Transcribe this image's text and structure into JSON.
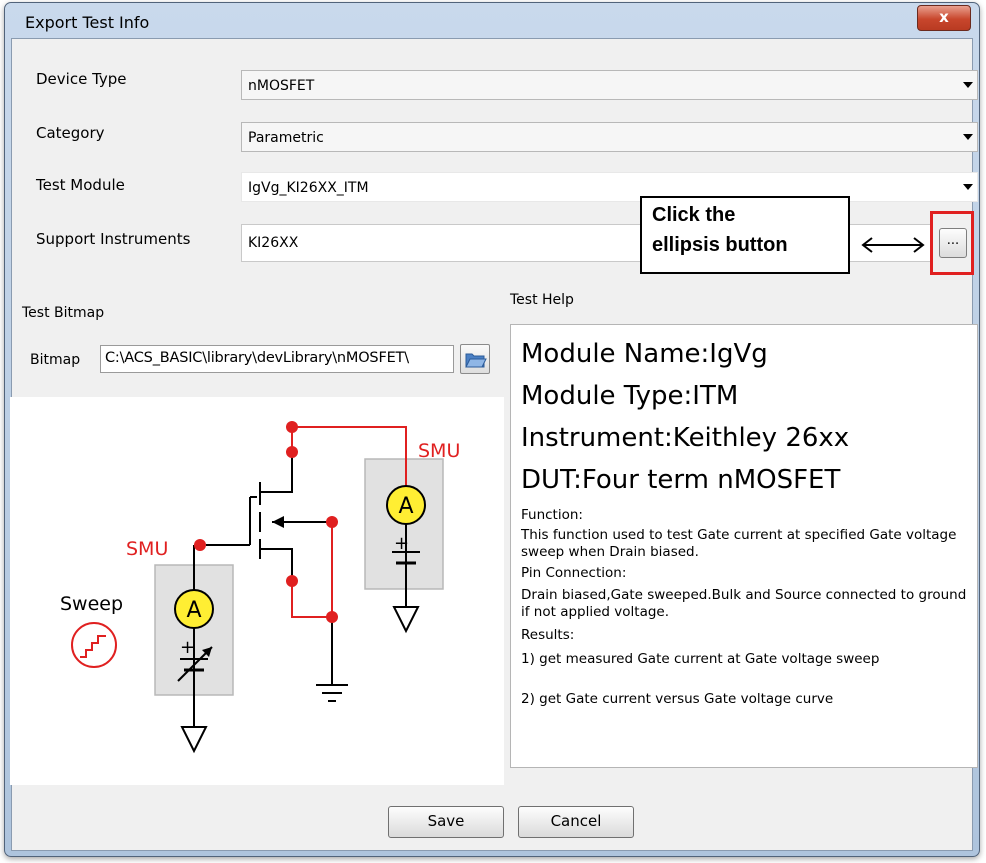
{
  "window": {
    "title": "Export Test Info",
    "close_glyph": "x"
  },
  "fields": {
    "device_type_label": "Device Type",
    "device_type_value": "nMOSFET",
    "category_label": "Category",
    "category_value": "Parametric",
    "test_module_label": "Test Module",
    "test_module_value": "IgVg_KI26XX_ITM",
    "support_instruments_label": "Support Instruments",
    "support_instruments_value": "KI26XX",
    "ellipsis_label": "..."
  },
  "callout": {
    "line1": "Click the",
    "line2": "ellipsis button"
  },
  "bitmap": {
    "section_label": "Test Bitmap",
    "label": "Bitmap",
    "path": "C:\\ACS_BASIC\\library\\devLibrary\\nMOSFET\\",
    "browse_icon": "folder-open-icon"
  },
  "diagram": {
    "smu_drain": "SMU",
    "smu_gate": "SMU",
    "sweep": "Sweep",
    "ammeter": "A",
    "plus": "+"
  },
  "help": {
    "label": "Test Help",
    "module_name": "Module Name:IgVg",
    "module_type": "Module Type:ITM",
    "instrument": "Instrument:Keithley 26xx",
    "dut": "DUT:Four term nMOSFET",
    "function_heading": "Function:",
    "function_text": "This function used to test Gate current at specified Gate voltage sweep when Drain biased.",
    "pin_heading": "Pin Connection:",
    "pin_text": "Drain biased,Gate sweeped.Bulk and Source connected to ground if not applied voltage.",
    "results_heading": "Results:",
    "result1": "1) get measured Gate current at Gate voltage sweep",
    "result2": "2) get Gate current versus Gate voltage curve"
  },
  "buttons": {
    "save": "Save",
    "cancel": "Cancel"
  },
  "colors": {
    "accent_red": "#e02020",
    "meter_yellow": "#ffee33",
    "panel_grey": "#e1e1e1"
  }
}
